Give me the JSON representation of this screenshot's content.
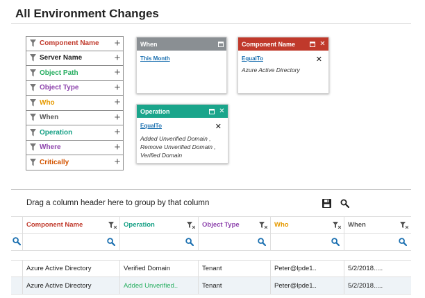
{
  "page": {
    "title": "All Environment Changes"
  },
  "colors": {
    "component": "#c0392b",
    "server": "#333333",
    "object_path": "#27ae60",
    "object_type": "#8e44ad",
    "who": "#e69a00",
    "when": "#555555",
    "operation": "#16a085",
    "where": "#8e44ad",
    "critically": "#d35400",
    "when_header": "#8a8f93",
    "component_header": "#c0392b",
    "operation_header": "#1aa58b",
    "link": "#1a6fb0"
  },
  "filters": [
    {
      "label": "Component Name",
      "color": "#c0392b"
    },
    {
      "label": "Server Name",
      "color": "#222222"
    },
    {
      "label": "Object Path",
      "color": "#27ae60"
    },
    {
      "label": "Object Type",
      "color": "#8e44ad"
    },
    {
      "label": "Who",
      "color": "#e69a00"
    },
    {
      "label": "When",
      "color": "#555555"
    },
    {
      "label": "Operation",
      "color": "#16a085"
    },
    {
      "label": "Where",
      "color": "#8e44ad"
    },
    {
      "label": "Critically",
      "color": "#d35400"
    }
  ],
  "cards": {
    "when": {
      "title": "When",
      "link": "This Month"
    },
    "component": {
      "title": "Component Name",
      "link": "EqualTo",
      "value": "Azure Active Directory"
    },
    "operation": {
      "title": "Operation",
      "link": "EqualTo",
      "value": "Added Unverified Domain , Remove Unverified Domain , Verified Domain"
    }
  },
  "grid": {
    "group_text": "Drag a column header here to group by that column",
    "columns": [
      {
        "label": "Component Name",
        "color": "#c0392b"
      },
      {
        "label": "Operation",
        "color": "#16a085"
      },
      {
        "label": "Object Type",
        "color": "#8e44ad"
      },
      {
        "label": "Who",
        "color": "#e69a00"
      },
      {
        "label": "When",
        "color": "#555555"
      }
    ],
    "rows": [
      [
        "Azure Active Directory",
        "Verified Domain",
        "Tenant",
        "Peter@lpde1..",
        "5/2/2018....."
      ],
      [
        "Azure Active Directory",
        "Added Unverified..",
        "Tenant",
        "Peter@lpde1..",
        "5/2/2018....."
      ]
    ]
  },
  "icons": {
    "filter": "funnel-icon",
    "add": "plus-icon",
    "save": "floppy-disk-icon",
    "search": "magnifier-icon",
    "close": "close-icon",
    "maximize": "maximize-icon"
  }
}
